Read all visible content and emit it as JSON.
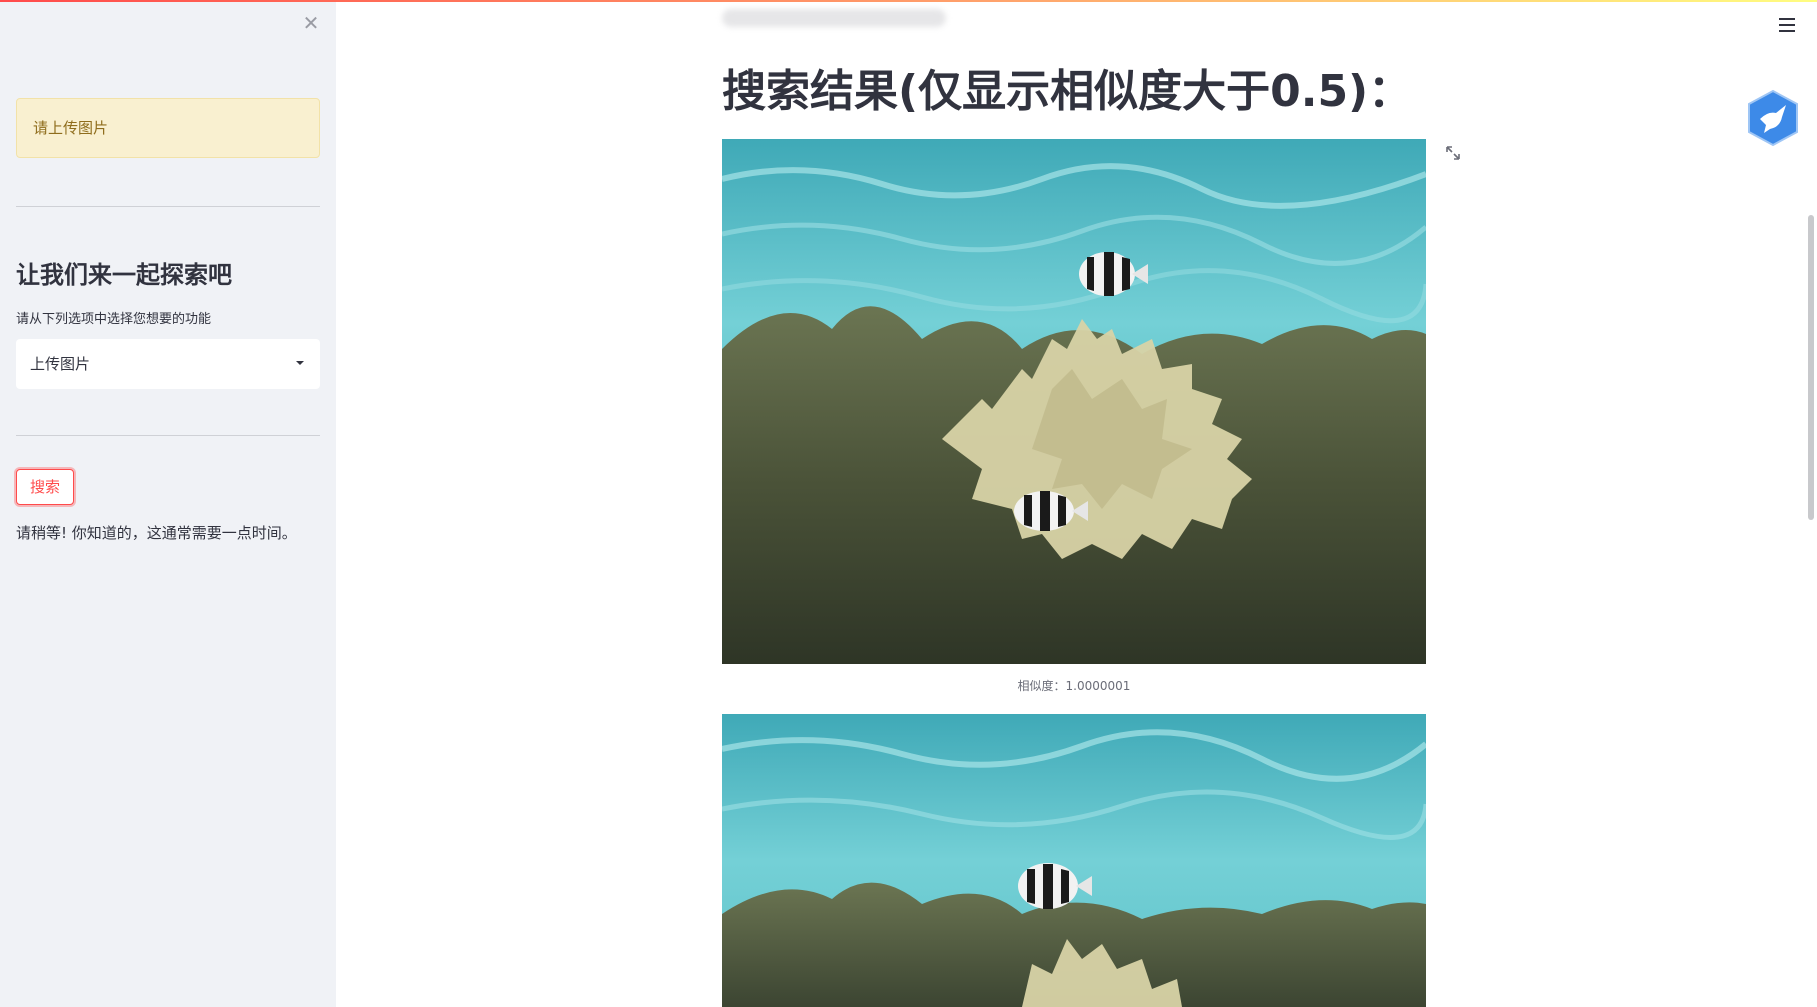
{
  "sidebar": {
    "warning": "请上传图片",
    "heading": "让我们来一起探索吧",
    "select_label": "请从下列选项中选择您想要的功能",
    "select_value": "上传图片",
    "search_button": "搜索",
    "wait_message": "请稍等! 你知道的，这通常需要一点时间。"
  },
  "main": {
    "title": "搜索结果(仅显示相似度大于0.5)：",
    "results": [
      {
        "caption": "相似度：1.0000001"
      }
    ]
  },
  "icons": {
    "close": "close-icon",
    "expand": "expand-icon",
    "menu": "hamburger-menu-icon",
    "badge": "bird-badge-icon",
    "dropdown": "chevron-down-icon"
  },
  "colors": {
    "accent": "#ff4b4b",
    "sidebar_bg": "#f0f2f6",
    "warning_bg": "#f9f0d0",
    "warning_text": "#8f6d1c",
    "badge_blue": "#3d8ae8"
  }
}
